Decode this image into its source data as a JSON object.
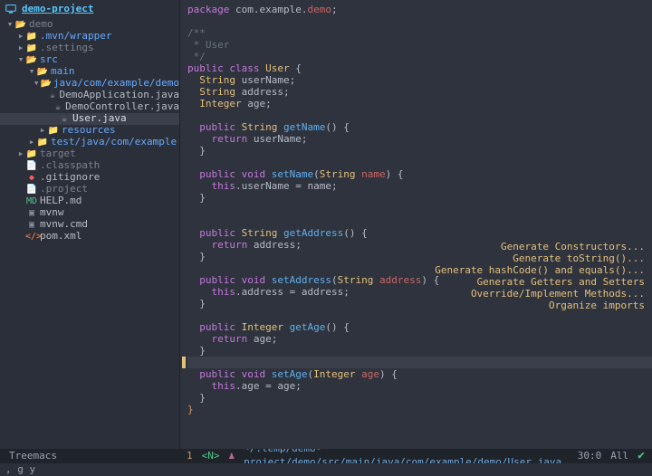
{
  "project": {
    "name": "demo-project"
  },
  "tree": [
    {
      "depth": 0,
      "expanded": true,
      "kind": "folder-o",
      "label": "demo",
      "cls": "dim"
    },
    {
      "depth": 1,
      "expanded": false,
      "kind": "folder-c",
      "label": ".mvn/wrapper",
      "cls": "folder"
    },
    {
      "depth": 1,
      "expanded": false,
      "kind": "folder-c",
      "label": ".settings",
      "cls": "dim"
    },
    {
      "depth": 1,
      "expanded": true,
      "kind": "folder-o",
      "label": "src",
      "cls": "folder"
    },
    {
      "depth": 2,
      "expanded": true,
      "kind": "folder-o",
      "label": "main",
      "cls": "folder"
    },
    {
      "depth": 3,
      "expanded": true,
      "kind": "folder-o",
      "label": "java/com/example/demo",
      "cls": "folder"
    },
    {
      "depth": 4,
      "expanded": null,
      "kind": "java",
      "label": "DemoApplication.java",
      "cls": "java"
    },
    {
      "depth": 4,
      "expanded": null,
      "kind": "java",
      "label": "DemoController.java",
      "cls": "java"
    },
    {
      "depth": 4,
      "expanded": null,
      "kind": "java",
      "label": "User.java",
      "cls": "cur",
      "hl": true
    },
    {
      "depth": 3,
      "expanded": false,
      "kind": "folder-c",
      "label": "resources",
      "cls": "folder"
    },
    {
      "depth": 2,
      "expanded": false,
      "kind": "folder-c",
      "label": "test/java/com/example",
      "cls": "folder"
    },
    {
      "depth": 1,
      "expanded": false,
      "kind": "folder-c",
      "label": "target",
      "cls": "dim"
    },
    {
      "depth": 1,
      "expanded": null,
      "kind": "file",
      "label": ".classpath",
      "cls": "dim"
    },
    {
      "depth": 1,
      "expanded": null,
      "kind": "git",
      "label": ".gitignore",
      "cls": "java"
    },
    {
      "depth": 1,
      "expanded": null,
      "kind": "file",
      "label": ".project",
      "cls": "dim"
    },
    {
      "depth": 1,
      "expanded": null,
      "kind": "md",
      "label": "HELP.md",
      "cls": "java"
    },
    {
      "depth": 1,
      "expanded": null,
      "kind": "cmd",
      "label": "mvnw",
      "cls": "java"
    },
    {
      "depth": 1,
      "expanded": null,
      "kind": "cmd",
      "label": "mvnw.cmd",
      "cls": "java"
    },
    {
      "depth": 1,
      "expanded": null,
      "kind": "xml",
      "label": "pom.xml",
      "cls": "java"
    }
  ],
  "icons": {
    "folder-o": "📂",
    "folder-c": "📁",
    "java": "☕",
    "file": "📄",
    "git": "◆",
    "md": "MD",
    "cmd": "▣",
    "xml": "</>"
  },
  "code": [
    {
      "h": "<span class='k'>package</span> <span class='p'>com.example.</span><span class='s'>demo</span><span class='p'>;</span>"
    },
    {
      "h": ""
    },
    {
      "h": "<span class='c'>/**</span>"
    },
    {
      "h": "<span class='c'> * User</span>"
    },
    {
      "h": "<span class='c'> */</span>"
    },
    {
      "h": "<span class='k'>public</span> <span class='k'>class</span> <span class='t'>User</span> <span class='p'>{</span>"
    },
    {
      "h": "  <span class='t'>String</span> <span class='p'>userName;</span>"
    },
    {
      "h": "  <span class='t'>String</span> <span class='p'>address;</span>"
    },
    {
      "h": "  <span class='t'>Integer</span> <span class='p'>age;</span>"
    },
    {
      "h": ""
    },
    {
      "h": "  <span class='k'>public</span> <span class='t'>String</span> <span class='m'>getName</span><span class='p'>() {</span>"
    },
    {
      "h": "    <span class='k'>return</span> <span class='p'>userName;</span>"
    },
    {
      "h": "  <span class='p'>}</span>"
    },
    {
      "h": ""
    },
    {
      "h": "  <span class='k'>public</span> <span class='k'>void</span> <span class='m'>setName</span><span class='p'>(</span><span class='t'>String</span> <span class='s'>name</span><span class='p'>) {</span>"
    },
    {
      "h": "    <span class='this'>this</span><span class='p'>.userName = name;</span>"
    },
    {
      "h": "  <span class='p'>}</span>"
    },
    {
      "h": ""
    },
    {
      "h": ""
    },
    {
      "h": "  <span class='k'>public</span> <span class='t'>String</span> <span class='m'>getAddress</span><span class='p'>() {</span>"
    },
    {
      "h": "    <span class='k'>return</span> <span class='p'>address;</span>"
    },
    {
      "h": "  <span class='p'>}</span>"
    },
    {
      "h": ""
    },
    {
      "h": "  <span class='k'>public</span> <span class='k'>void</span> <span class='m'>setAddress</span><span class='p'>(</span><span class='t'>String</span> <span class='s'>address</span><span class='p'>) {</span>"
    },
    {
      "h": "    <span class='this'>this</span><span class='p'>.address = address;</span>"
    },
    {
      "h": "  <span class='p'>}</span>"
    },
    {
      "h": ""
    },
    {
      "h": "  <span class='k'>public</span> <span class='t'>Integer</span> <span class='m'>getAge</span><span class='p'>() {</span>"
    },
    {
      "h": "    <span class='k'>return</span> <span class='p'>age;</span>"
    },
    {
      "h": "  <span class='p'>}</span>"
    },
    {
      "h": "",
      "cursor": true
    },
    {
      "h": "  <span class='k'>public</span> <span class='k'>void</span> <span class='m'>setAge</span><span class='p'>(</span><span class='t'>Integer</span> <span class='s'>age</span><span class='p'>) {</span>"
    },
    {
      "h": "    <span class='this'>this</span><span class='p'>.age = age;</span>"
    },
    {
      "h": "  <span class='p'>}</span>"
    },
    {
      "h": "<span class='br'>}</span>"
    }
  ],
  "hints": [
    "Generate Constructors...",
    "Generate toString()...",
    "Generate hashCode() and equals()...",
    "Generate Getters and Setters",
    "Override/Implement Methods...",
    "Organize imports"
  ],
  "status": {
    "left": "Treemacs",
    "line": "1",
    "mode": "<N>",
    "path": "~/.temp/demo-project/demo/src/main/java/com/example/demo/User.java",
    "pos": "30:0",
    "all": "All"
  },
  "minibuffer": ", g y"
}
